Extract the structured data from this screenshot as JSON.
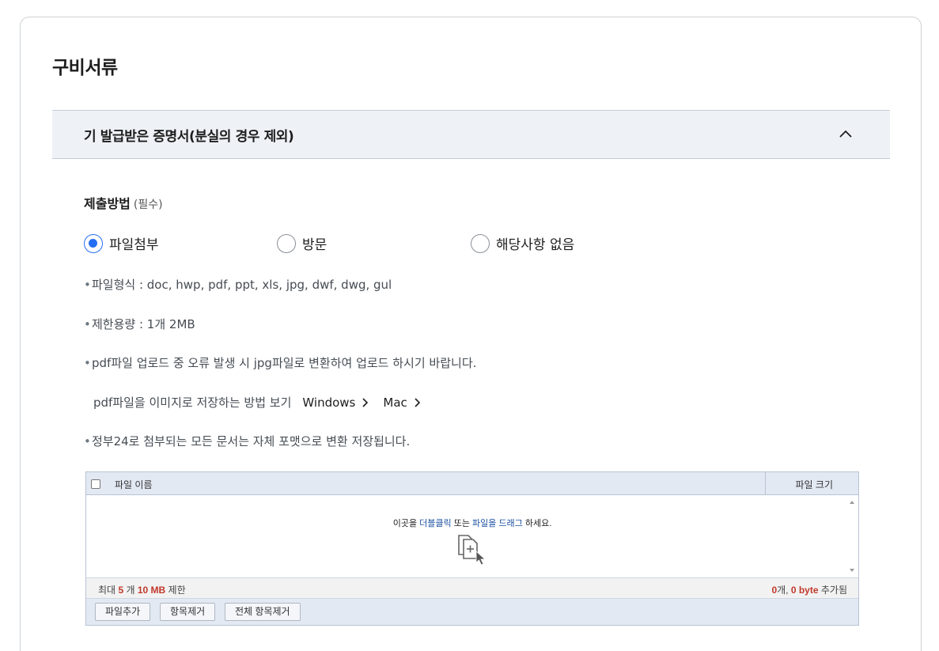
{
  "section": {
    "title": "구비서류"
  },
  "accordion": {
    "title": "기 발급받은 증명서(분실의 경우 제외)",
    "toggle_icon": "chevron-up-icon"
  },
  "submission": {
    "label": "제출방법",
    "required": "(필수)",
    "options": [
      {
        "label": "파일첨부",
        "checked": true
      },
      {
        "label": "방문",
        "checked": false
      },
      {
        "label": "해당사항 없음",
        "checked": false
      }
    ]
  },
  "notes": {
    "file_format": "파일형식 : doc, hwp, pdf, ppt, xls, jpg, dwf, dwg, gul",
    "size_limit": "제한용량 : 1개 2MB",
    "pdf_error": "pdf파일 업로드 중 오류 발생 시 jpg파일로 변환하여 업로드 하시기 바랍니다.",
    "save_guide": "pdf파일을 이미지로 저장하는 방법 보기",
    "windows_link": "Windows",
    "mac_link": "Mac",
    "convert_notice": "정부24로 첨부되는 모든 문서는 자체 포맷으로 변환 저장됩니다."
  },
  "uploader": {
    "col_name": "파일 이름",
    "col_size": "파일 크기",
    "drop_prefix": "이곳을",
    "drop_dblclick": "더블클릭",
    "drop_or": "또는",
    "drop_drag": "파일을 드래그",
    "drop_suffix": "하세요.",
    "limit_prefix": "최대",
    "limit_count": "5",
    "limit_count_unit": "개",
    "limit_size": "10 MB",
    "limit_suffix": "제한",
    "added_count": "0",
    "added_count_unit": "개,",
    "added_size": "0 byte",
    "added_suffix": "추가됨",
    "buttons": {
      "add": "파일추가",
      "remove": "항목제거",
      "remove_all": "전체 항목제거"
    }
  },
  "colors": {
    "accent": "#256ef4",
    "header_bg": "#eef2f7",
    "uploader_bg": "#e3e9f3",
    "limit_red": "#c0392b"
  }
}
